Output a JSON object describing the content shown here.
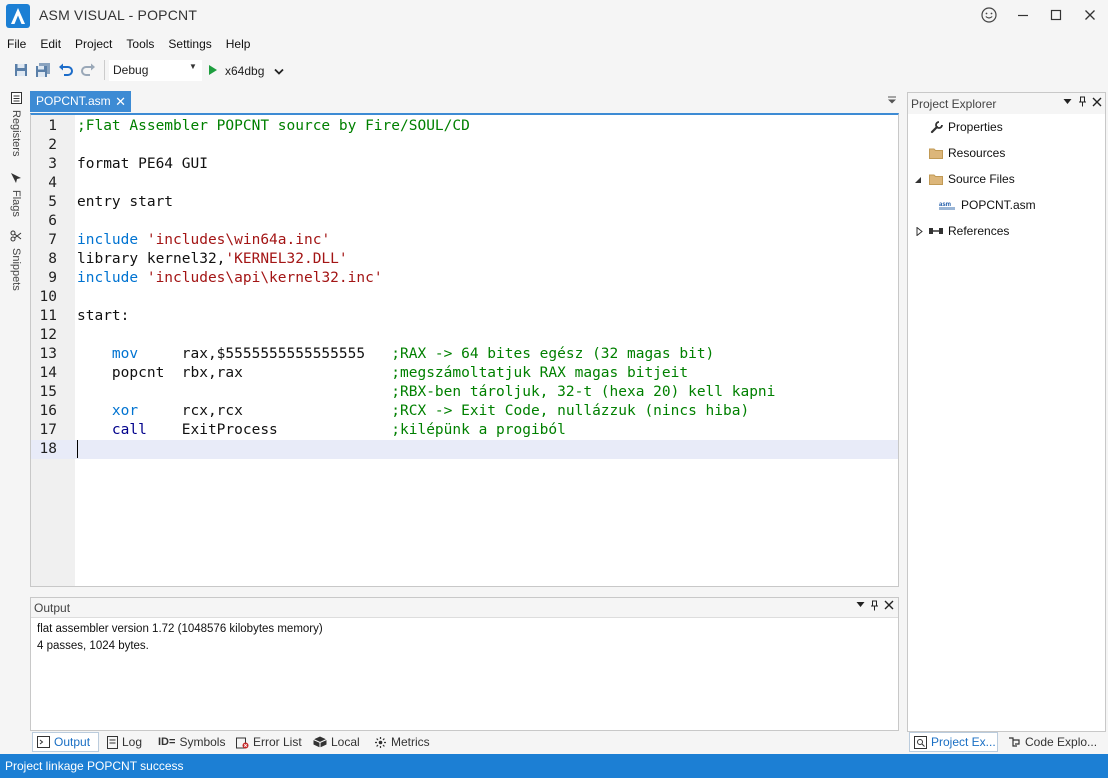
{
  "app": {
    "title": "ASM VISUAL - POPCNT"
  },
  "menu": [
    "File",
    "Edit",
    "Project",
    "Tools",
    "Settings",
    "Help"
  ],
  "toolbar": {
    "configuration": "Debug",
    "debugger": "x64dbg"
  },
  "side_tabs": [
    "Registers",
    "Flags",
    "Snippets"
  ],
  "editor": {
    "tab_label": "POPCNT.asm",
    "lines": [
      {
        "n": "1",
        "segments": [
          {
            "t": ";Flat Assembler POPCNT source by Fire/SOUL/CD",
            "c": "comment"
          }
        ]
      },
      {
        "n": "2",
        "segments": []
      },
      {
        "n": "3",
        "segments": [
          {
            "t": "format PE64 GUI",
            "c": "plain"
          }
        ]
      },
      {
        "n": "4",
        "segments": []
      },
      {
        "n": "5",
        "segments": [
          {
            "t": "entry start",
            "c": "plain"
          }
        ]
      },
      {
        "n": "6",
        "segments": []
      },
      {
        "n": "7",
        "segments": [
          {
            "t": "include",
            "c": "kw"
          },
          {
            "t": " ",
            "c": "plain"
          },
          {
            "t": "'includes\\win64a.inc'",
            "c": "str"
          }
        ]
      },
      {
        "n": "8",
        "segments": [
          {
            "t": "library kernel32,",
            "c": "plain"
          },
          {
            "t": "'KERNEL32.DLL'",
            "c": "str"
          }
        ]
      },
      {
        "n": "9",
        "segments": [
          {
            "t": "include",
            "c": "kw"
          },
          {
            "t": " ",
            "c": "plain"
          },
          {
            "t": "'includes\\api\\kernel32.inc'",
            "c": "str"
          }
        ]
      },
      {
        "n": "10",
        "segments": []
      },
      {
        "n": "11",
        "segments": [
          {
            "t": "start:",
            "c": "plain"
          }
        ]
      },
      {
        "n": "12",
        "segments": []
      },
      {
        "n": "13",
        "segments": [
          {
            "t": "    mov",
            "c": "kw"
          },
          {
            "t": "     rax,$5555555555555555   ",
            "c": "plain"
          },
          {
            "t": ";RAX -> 64 bites egész (32 magas bit)",
            "c": "comment"
          }
        ]
      },
      {
        "n": "14",
        "segments": [
          {
            "t": "    popcnt  rbx,rax                 ",
            "c": "plain"
          },
          {
            "t": ";megszámoltatjuk RAX magas bitjeit",
            "c": "comment"
          }
        ]
      },
      {
        "n": "15",
        "segments": [
          {
            "t": "                                    ",
            "c": "plain"
          },
          {
            "t": ";RBX-ben tároljuk, 32-t (hexa 20) kell kapni",
            "c": "comment"
          }
        ]
      },
      {
        "n": "16",
        "segments": [
          {
            "t": "    xor",
            "c": "kw"
          },
          {
            "t": "     rcx,rcx                 ",
            "c": "plain"
          },
          {
            "t": ";RCX -> Exit Code, nullázzuk (nincs hiba)",
            "c": "comment"
          }
        ]
      },
      {
        "n": "17",
        "segments": [
          {
            "t": "    call",
            "c": "kw2"
          },
          {
            "t": "    ExitProcess             ",
            "c": "plain"
          },
          {
            "t": ";kilépünk a progiból",
            "c": "comment"
          }
        ]
      },
      {
        "n": "18",
        "segments": []
      }
    ]
  },
  "output": {
    "title": "Output",
    "lines": [
      "flat assembler  version 1.72  (1048576 kilobytes memory)",
      "4 passes, 1024 bytes."
    ]
  },
  "bottom_tabs": [
    "Output",
    "Log",
    "Symbols",
    "Error List",
    "Local",
    "Metrics"
  ],
  "explorer": {
    "title": "Project Explorer",
    "items": [
      {
        "label": "Properties",
        "icon": "wrench-icon"
      },
      {
        "label": "Resources",
        "icon": "folder-icon"
      },
      {
        "label": "Source Files",
        "icon": "folder-icon"
      },
      {
        "label": "POPCNT.asm",
        "icon": "asm-file-icon"
      },
      {
        "label": "References",
        "icon": "references-icon"
      }
    ]
  },
  "right_tabs": [
    "Project Ex...",
    "Code Explo..."
  ],
  "status": {
    "text": "Project linkage POPCNT success"
  },
  "colors": {
    "accent": "#1c7fd4",
    "tab_active": "#3d8bd4",
    "comment": "#008000",
    "keyword": "#0073d1",
    "string": "#a31515"
  }
}
